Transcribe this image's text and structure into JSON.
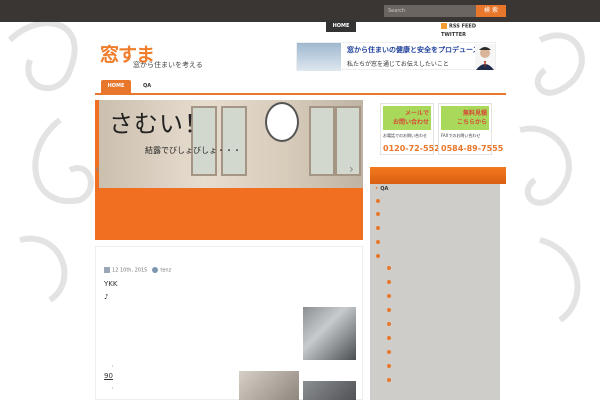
{
  "top_bar": {
    "search_placeholder": "Search",
    "search_button": "検 索",
    "home_tab": "HOME"
  },
  "header": {
    "logo_main": "窓すま",
    "logo_sub": "窓から住まいを考える",
    "banner_line1": "窓から住まいの健康と安全をプロデュース",
    "banner_line2": "私たちが窓を通じてお伝えしたいこと",
    "rss_label": "RSS FEED",
    "twitter_label": "TWITTER"
  },
  "nav": {
    "items": [
      {
        "label": "HOME",
        "active": true
      },
      {
        "label": "QA",
        "active": false
      }
    ]
  },
  "slider": {
    "title": "さむい！",
    "subtitle": "結露でびしょびしょ・・・",
    "prev_icon": "‹",
    "next_icon": "›"
  },
  "post": {
    "date": "12 10th, 2015",
    "author": "tenz",
    "heading": "YKK",
    "mark": "♪",
    "dot": "・",
    "number": "90"
  },
  "sidebar": {
    "ad_mail": {
      "line1": "メールで",
      "line2": "お問い合わせ",
      "caption": "お電話でのお問い合わせ",
      "phone": "0120-72-5525"
    },
    "ad_estimate": {
      "line1": "無料見積",
      "line2": "こちらから",
      "caption": "FAXでのお問い合わせ",
      "phone": "0584-89-7555"
    },
    "link_qa": "QA"
  },
  "colors": {
    "accent": "#e8762b",
    "topbar": "#3a3633",
    "ad_green": "#a9d95b",
    "sidebar_gray": "#cfcdca"
  }
}
